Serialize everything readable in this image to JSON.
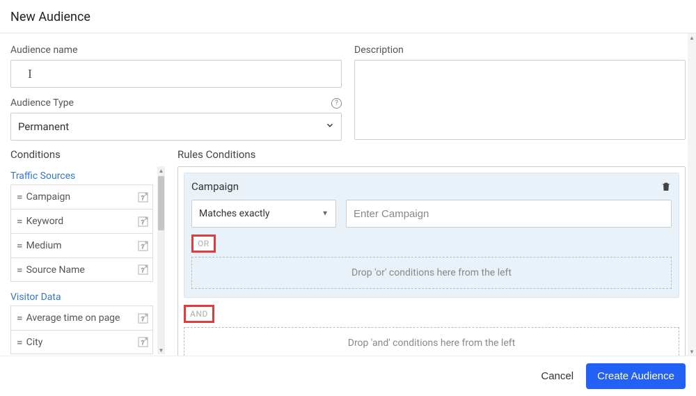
{
  "header": {
    "title": "New Audience"
  },
  "form": {
    "name_label": "Audience name",
    "name_value": "",
    "type_label": "Audience Type",
    "type_value": "Permanent",
    "desc_label": "Description",
    "desc_value": ""
  },
  "conditions": {
    "title": "Conditions",
    "groups": [
      {
        "title": "Traffic Sources",
        "items": [
          "Campaign",
          "Keyword",
          "Medium",
          "Source Name"
        ]
      },
      {
        "title": "Visitor Data",
        "items": [
          "Average time on page",
          "City"
        ]
      }
    ]
  },
  "rules": {
    "title": "Rules Conditions",
    "group_label": "Campaign",
    "operator": "Matches exactly",
    "value_placeholder": "Enter Campaign",
    "or_label": "OR",
    "or_drop": "Drop 'or' conditions here from the left",
    "and_label": "AND",
    "and_drop": "Drop 'and' conditions here from the left"
  },
  "footer": {
    "cancel": "Cancel",
    "create": "Create Audience"
  }
}
